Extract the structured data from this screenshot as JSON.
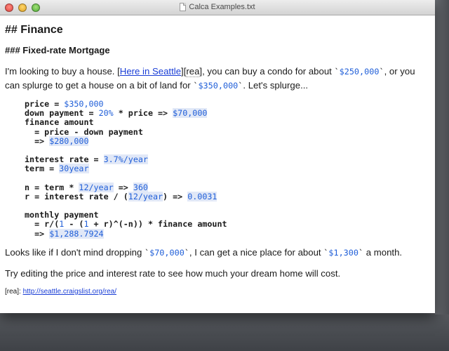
{
  "window": {
    "title": "Calca Examples.txt"
  },
  "doc": {
    "h_finance": "## Finance",
    "h_mortgage": "### Fixed-rate Mortgage",
    "p1": {
      "a": "I'm looking to buy a house. [",
      "link_text": "Here in Seattle",
      "b": "][",
      "ref": "rea",
      "c": "], you can buy a condo for about ",
      "price1": "$250,000",
      "d": ", or you can splurge to get a house on a bit of land for ",
      "price2": "$350,000",
      "e": ". Let's splurge..."
    },
    "code": {
      "l1a": "price = ",
      "l1v": "$350,000",
      "l2a": "down payment = ",
      "l2b": "20%",
      "l2c": " * price => ",
      "l2d": "$70,000",
      "l3": "finance amount",
      "l4": "  = price - down payment",
      "l5a": "  => ",
      "l5b": "$280,000",
      "l6a": "interest rate = ",
      "l6b": "3.7%/year",
      "l7a": "term = ",
      "l7b": "30year",
      "l8a": "n = term * ",
      "l8b": "12/year",
      "l8c": " => ",
      "l8d": "360",
      "l9a": "r = interest rate / (",
      "l9b": "12/year",
      "l9c": ") => ",
      "l9d": "0.0031",
      "l10": "monthly payment",
      "l11a": "  = r/(",
      "l11b": "1",
      "l11c": " - (",
      "l11d": "1",
      "l11e": " + r)^(-n)) * finance amount",
      "l12a": "  => ",
      "l12b": "$1,288.7924"
    },
    "p2": {
      "a": "Looks like if I don't mind dropping ",
      "v1": "$70,000",
      "b": ", I can get a nice place for about ",
      "v2": "$1,300",
      "c": " a month."
    },
    "p3": "Try editing the price and interest rate to see how much your dream home will cost.",
    "ref_line": {
      "label": "[rea]: ",
      "url": "http://seattle.craigslist.org/rea/"
    }
  },
  "colors": {
    "number": "#1f5ed8",
    "link": "#1a3ed6",
    "highlight": "#e1e8f7"
  }
}
